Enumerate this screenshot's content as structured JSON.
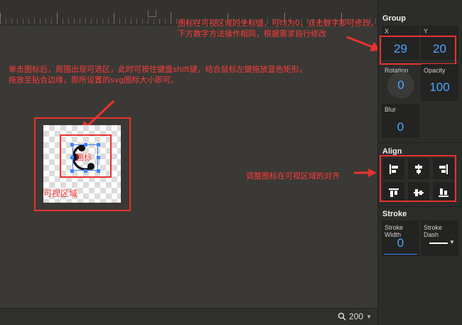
{
  "canvas": {
    "frame_label": "可视区域",
    "icon_label": "图标"
  },
  "annotations": {
    "coord_line1": "图标在可视区域的坐标值，可均为0，双击数字即可修改，",
    "coord_line2": "下方数字方法操作相同，根据需求自行修改",
    "click_line1": "单击图标后，周围出现可选区，此时可按住键盘shift键，结合鼠标左键拖放蓝色矩形，",
    "click_line2": "拖放至贴合边缘，即所设置的svg图标大小即可。",
    "align_note": "调整图标在可视区域的对齐"
  },
  "status_bar": {
    "zoom_value": "200",
    "zoom_icon": "search-icon"
  },
  "panel": {
    "group": {
      "title": "Group",
      "x_label": "X",
      "x_value": "29",
      "y_label": "Y",
      "y_value": "20",
      "rotation_label": "Rotation",
      "rotation_value": "0",
      "opacity_label": "Opacity",
      "opacity_value": "100",
      "blur_label": "Blur",
      "blur_value": "0"
    },
    "align": {
      "title": "Align",
      "buttons": [
        "align-left-icon",
        "align-center-horizontal-icon",
        "align-right-icon",
        "align-top-icon",
        "align-center-vertical-icon",
        "align-bottom-icon"
      ]
    },
    "stroke": {
      "title": "Stroke",
      "width_label": "Stroke Width",
      "width_value": "0",
      "dash_label": "Stroke Dash"
    }
  },
  "colors": {
    "annotation": "#e8332f",
    "accent": "#3d83ff",
    "value_text": "#4ea6ff",
    "canvas_bg": "#3a3935",
    "panel_bg": "#2c2c2a"
  }
}
